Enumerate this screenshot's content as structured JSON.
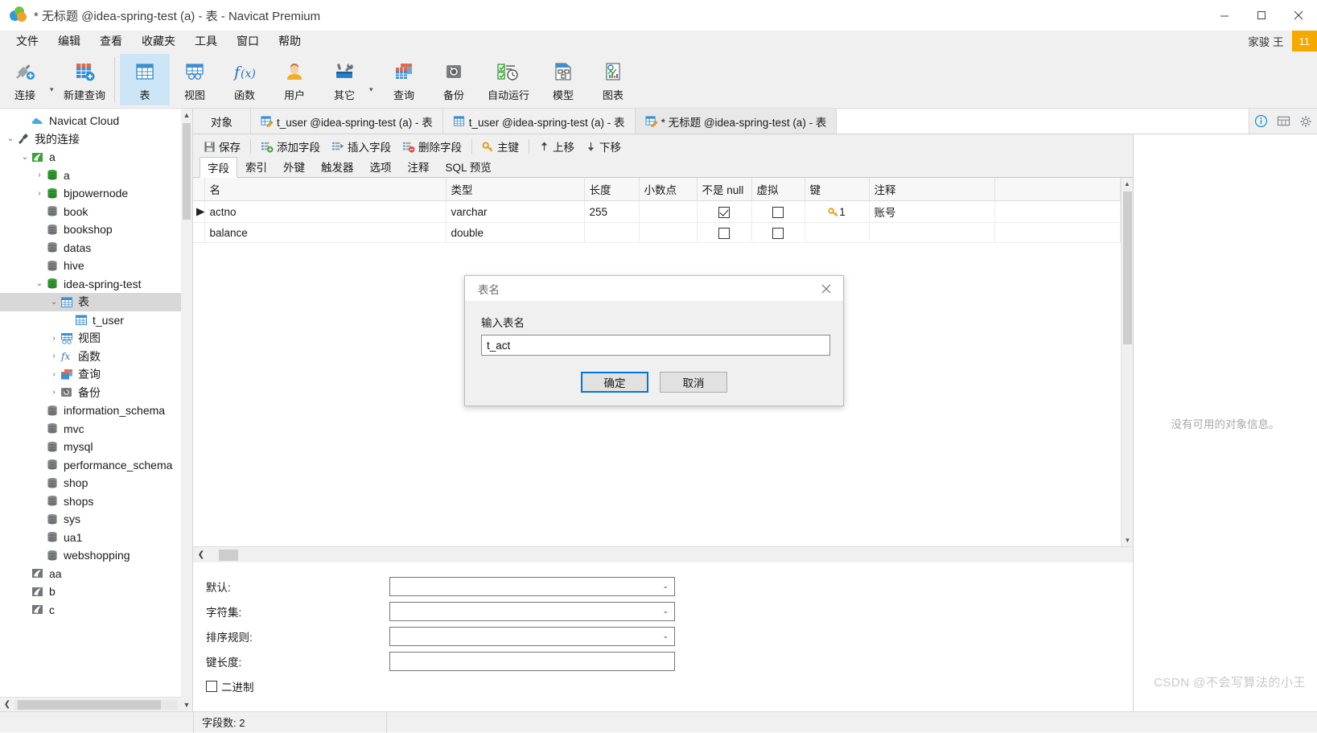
{
  "window": {
    "title": "* 无标题 @idea-spring-test (a) - 表 - Navicat Premium",
    "minimize": "−",
    "maximize": "□",
    "close": "✕"
  },
  "menubar": {
    "items": [
      "文件",
      "编辑",
      "查看",
      "收藏夹",
      "工具",
      "窗口",
      "帮助"
    ],
    "user": "家骏 王",
    "badge": "11"
  },
  "ribbon": {
    "items": [
      {
        "label": "连接",
        "icon": "connection-icon"
      },
      {
        "label": "新建查询",
        "icon": "new-query-icon"
      },
      {
        "label": "表",
        "icon": "table-icon",
        "selected": true
      },
      {
        "label": "视图",
        "icon": "view-icon"
      },
      {
        "label": "函数",
        "icon": "function-icon"
      },
      {
        "label": "用户",
        "icon": "user-icon"
      },
      {
        "label": "其它",
        "icon": "other-icon"
      },
      {
        "label": "查询",
        "icon": "query-icon"
      },
      {
        "label": "备份",
        "icon": "backup-icon"
      },
      {
        "label": "自动运行",
        "icon": "automation-icon"
      },
      {
        "label": "模型",
        "icon": "model-icon"
      },
      {
        "label": "图表",
        "icon": "chart-icon"
      }
    ]
  },
  "sidebar": {
    "items": [
      {
        "label": "Navicat Cloud",
        "indent": 1,
        "arrow": "",
        "icon": "cloud-icon"
      },
      {
        "label": "我的连接",
        "indent": 0,
        "arrow": "⌄",
        "icon": "connection-icon"
      },
      {
        "label": "a",
        "indent": 1,
        "arrow": "⌄",
        "icon": "mysql-icon"
      },
      {
        "label": "a",
        "indent": 2,
        "arrow": "›",
        "icon": "database-icon"
      },
      {
        "label": "bjpowernode",
        "indent": 2,
        "arrow": "›",
        "icon": "database-icon"
      },
      {
        "label": "book",
        "indent": 2,
        "arrow": "",
        "icon": "database-gray-icon"
      },
      {
        "label": "bookshop",
        "indent": 2,
        "arrow": "",
        "icon": "database-gray-icon"
      },
      {
        "label": "datas",
        "indent": 2,
        "arrow": "",
        "icon": "database-gray-icon"
      },
      {
        "label": "hive",
        "indent": 2,
        "arrow": "",
        "icon": "database-gray-icon"
      },
      {
        "label": "idea-spring-test",
        "indent": 2,
        "arrow": "⌄",
        "icon": "database-icon"
      },
      {
        "label": "表",
        "indent": 3,
        "arrow": "⌄",
        "icon": "table-icon",
        "selected": true
      },
      {
        "label": "t_user",
        "indent": 4,
        "arrow": "",
        "icon": "table-icon"
      },
      {
        "label": "视图",
        "indent": 3,
        "arrow": "›",
        "icon": "view-icon"
      },
      {
        "label": "函数",
        "indent": 3,
        "arrow": "›",
        "icon": "function-icon"
      },
      {
        "label": "查询",
        "indent": 3,
        "arrow": "›",
        "icon": "query-icon"
      },
      {
        "label": "备份",
        "indent": 3,
        "arrow": "›",
        "icon": "backup-icon"
      },
      {
        "label": "information_schema",
        "indent": 2,
        "arrow": "",
        "icon": "database-gray-icon"
      },
      {
        "label": "mvc",
        "indent": 2,
        "arrow": "",
        "icon": "database-gray-icon"
      },
      {
        "label": "mysql",
        "indent": 2,
        "arrow": "",
        "icon": "database-gray-icon"
      },
      {
        "label": "performance_schema",
        "indent": 2,
        "arrow": "",
        "icon": "database-gray-icon"
      },
      {
        "label": "shop",
        "indent": 2,
        "arrow": "",
        "icon": "database-gray-icon"
      },
      {
        "label": "shops",
        "indent": 2,
        "arrow": "",
        "icon": "database-gray-icon"
      },
      {
        "label": "sys",
        "indent": 2,
        "arrow": "",
        "icon": "database-gray-icon"
      },
      {
        "label": "ua1",
        "indent": 2,
        "arrow": "",
        "icon": "database-gray-icon"
      },
      {
        "label": "webshopping",
        "indent": 2,
        "arrow": "",
        "icon": "database-gray-icon"
      },
      {
        "label": "aa",
        "indent": 1,
        "arrow": "",
        "icon": "mysql-gray-icon"
      },
      {
        "label": "b",
        "indent": 1,
        "arrow": "",
        "icon": "mysql-gray-icon"
      },
      {
        "label": "c",
        "indent": 1,
        "arrow": "",
        "icon": "mysql-gray-icon"
      }
    ]
  },
  "tabs": {
    "object_label": "对象",
    "items": [
      {
        "label": "t_user @idea-spring-test (a) - 表",
        "icon": "table-design-icon",
        "active": false
      },
      {
        "label": "t_user @idea-spring-test (a) - 表",
        "icon": "table-icon",
        "active": false
      },
      {
        "label": "* 无标题 @idea-spring-test (a) - 表",
        "icon": "table-design-icon",
        "active": true
      }
    ],
    "right_buttons": [
      "info-icon",
      "grid-icon",
      "gear-icon"
    ]
  },
  "field_toolbar": {
    "buttons": [
      {
        "label": "保存",
        "icon": "save-icon"
      },
      {
        "label": "添加字段",
        "icon": "add-field-icon"
      },
      {
        "label": "插入字段",
        "icon": "insert-field-icon"
      },
      {
        "label": "删除字段",
        "icon": "delete-field-icon"
      },
      {
        "label": "主键",
        "icon": "primary-key-icon"
      },
      {
        "label": "上移",
        "icon": "move-up-icon"
      },
      {
        "label": "下移",
        "icon": "move-down-icon"
      }
    ]
  },
  "sub_tabs": {
    "items": [
      "字段",
      "索引",
      "外键",
      "触发器",
      "选项",
      "注释",
      "SQL 预览"
    ],
    "active": "字段"
  },
  "grid": {
    "columns": [
      "名",
      "类型",
      "长度",
      "小数点",
      "不是 null",
      "虚拟",
      "键",
      "注释"
    ],
    "rows": [
      {
        "selected": true,
        "name": "actno",
        "type": "varchar",
        "length": "255",
        "decimals": "",
        "not_null": true,
        "virtual": false,
        "key": "1",
        "comment": "账号"
      },
      {
        "selected": false,
        "name": "balance",
        "type": "double",
        "length": "",
        "decimals": "",
        "not_null": false,
        "virtual": false,
        "key": "",
        "comment": ""
      }
    ]
  },
  "properties": {
    "rows": [
      {
        "label": "默认:",
        "value": "",
        "type": "select"
      },
      {
        "label": "字符集:",
        "value": "",
        "type": "select"
      },
      {
        "label": "排序规则:",
        "value": "",
        "type": "select"
      },
      {
        "label": "键长度:",
        "value": "",
        "type": "text"
      }
    ],
    "checkbox_label": "二进制",
    "checkbox_checked": false
  },
  "right_panel": {
    "message": "没有可用的对象信息。"
  },
  "statusbar": {
    "field_count": "字段数: 2"
  },
  "dialog": {
    "title": "表名",
    "label": "输入表名",
    "value": "t_act",
    "ok": "确定",
    "cancel": "取消",
    "close_icon": "close-icon"
  },
  "watermark": "CSDN @不会写算法的小王"
}
